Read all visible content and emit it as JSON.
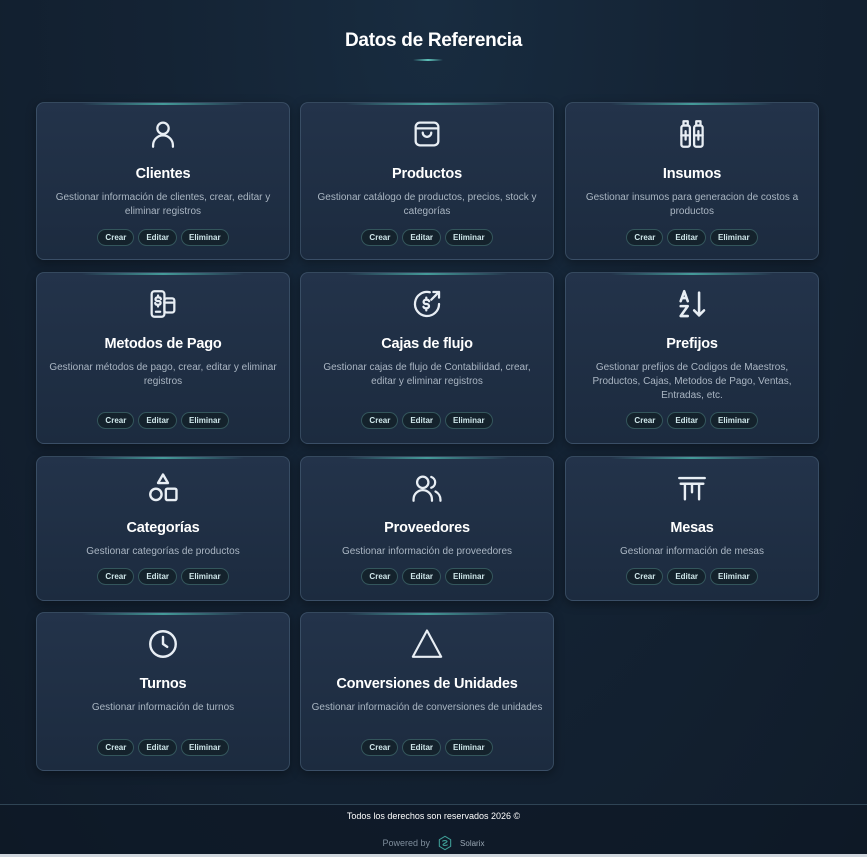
{
  "page": {
    "title": "Datos de Referencia"
  },
  "cards": [
    {
      "title": "Clientes",
      "description": "Gestionar información de clientes, crear, editar y eliminar registros",
      "icon": "user-icon",
      "actions": [
        "Crear",
        "Editar",
        "Eliminar"
      ]
    },
    {
      "title": "Productos",
      "description": "Gestionar catálogo de productos, precios, stock y categorías",
      "icon": "shopping-bag-icon",
      "actions": [
        "Crear",
        "Editar",
        "Eliminar"
      ]
    },
    {
      "title": "Insumos",
      "description": "Gestionar insumos para generacion de costos a productos",
      "icon": "bottles-icon",
      "actions": [
        "Crear",
        "Editar",
        "Eliminar"
      ]
    },
    {
      "title": "Metodos de Pago",
      "description": "Gestionar métodos de pago, crear, editar y eliminar registros",
      "icon": "payment-methods-icon",
      "actions": [
        "Crear",
        "Editar",
        "Eliminar"
      ]
    },
    {
      "title": "Cajas de flujo",
      "description": "Gestionar cajas de flujo de Contabilidad, crear, editar y eliminar registros",
      "icon": "cash-flow-icon",
      "actions": [
        "Crear",
        "Editar",
        "Eliminar"
      ]
    },
    {
      "title": "Prefijos",
      "description": "Gestionar prefijos de Codigos de Maestros, Productos, Cajas, Metodos de Pago, Ventas, Entradas, etc.",
      "icon": "sort-az-icon",
      "actions": [
        "Crear",
        "Editar",
        "Eliminar"
      ]
    },
    {
      "title": "Categorías",
      "description": "Gestionar categorías de productos",
      "icon": "shapes-icon",
      "actions": [
        "Crear",
        "Editar",
        "Eliminar"
      ]
    },
    {
      "title": "Proveedores",
      "description": "Gestionar información de proveedores",
      "icon": "users-icon",
      "actions": [
        "Crear",
        "Editar",
        "Eliminar"
      ]
    },
    {
      "title": "Mesas",
      "description": "Gestionar información de mesas",
      "icon": "table-icon",
      "actions": [
        "Crear",
        "Editar",
        "Eliminar"
      ]
    },
    {
      "title": "Turnos",
      "description": "Gestionar información de turnos",
      "icon": "clock-icon",
      "actions": [
        "Crear",
        "Editar",
        "Eliminar"
      ]
    },
    {
      "title": "Conversiones de Unidades",
      "description": "Gestionar información de conversiones de unidades",
      "icon": "triangle-icon",
      "actions": [
        "Crear",
        "Editar",
        "Eliminar"
      ]
    }
  ],
  "footer": {
    "copyright": "Todos los derechos son reservados 2026 ©",
    "powered_by": "Powered by",
    "brand": "Solarix"
  },
  "colors": {
    "accent": "#5ec2ba",
    "card_background": "#1f2f45",
    "page_background": "#142334"
  }
}
